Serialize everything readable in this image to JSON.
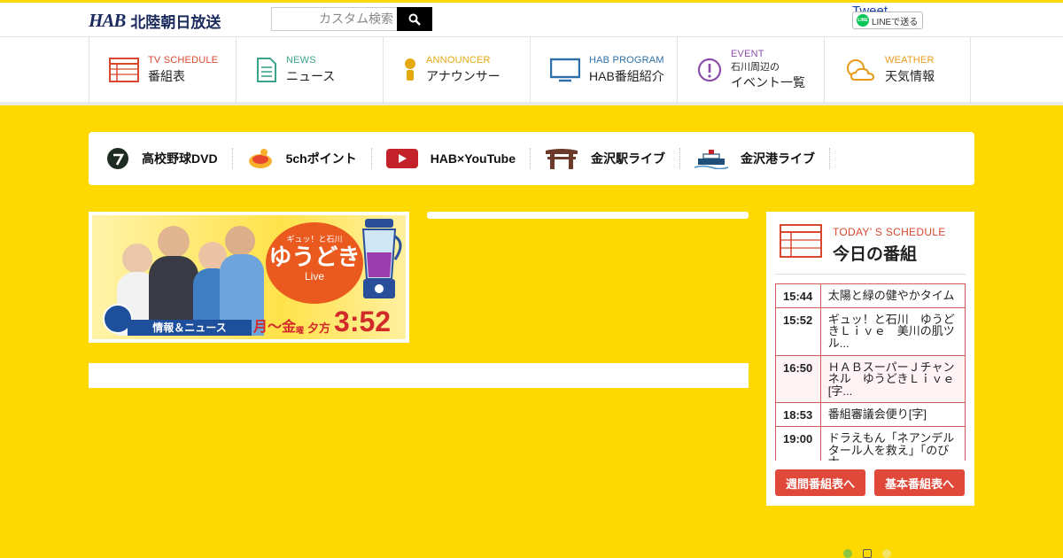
{
  "header": {
    "logo_mark": "HAB",
    "logo_name": "北陸朝日放送",
    "search_placeholder": "カスタム検索",
    "tweet_label": "Tweet",
    "line_label": "LINEで送る",
    "line_icon_text": "LINE"
  },
  "nav": [
    {
      "en": "TV SCHEDULE",
      "ja": "番組表",
      "color": "#d9482e",
      "icon": "tv-schedule-icon"
    },
    {
      "en": "NEWS",
      "ja": "ニュース",
      "color": "#3aa58b",
      "icon": "news-icon"
    },
    {
      "en": "ANNOUNCER",
      "ja": "アナウンサー",
      "color": "#e3a90f",
      "icon": "announcer-icon"
    },
    {
      "en": "HAB PROGRAM",
      "ja": "HAB番組紹介",
      "color": "#2d6fa8",
      "icon": "tv-monitor-icon"
    },
    {
      "en": "EVENT",
      "sub": "石川周辺の",
      "ja": "イベント一覧",
      "color": "#8a4ea8",
      "icon": "event-icon"
    },
    {
      "en": "WEATHER",
      "ja": "天気情報",
      "color": "#e89a1a",
      "icon": "weather-icon"
    }
  ],
  "quick_links": [
    {
      "label": "高校野球DVD",
      "icon": "baseball-dvd-icon"
    },
    {
      "label": "5chポイント",
      "icon": "5ch-point-icon"
    },
    {
      "label": "HAB×YouTube",
      "icon": "youtube-icon"
    },
    {
      "label": "金沢駅ライブ",
      "icon": "kanazawa-station-icon"
    },
    {
      "label": "金沢港ライブ",
      "icon": "kanazawa-port-icon"
    }
  ],
  "banner": {
    "tagline": "ギュッ！と石川",
    "title": "ゆうどき",
    "live": "Live",
    "genre": "情報＆ニュース",
    "days_prefix": "月〜金",
    "days_suffix": "曜",
    "period": "夕方",
    "time": "3:52"
  },
  "schedule": {
    "en_title": "TODAY’ S SCHEDULE",
    "ja_title": "今日の番組",
    "rows": [
      {
        "time": "15:44",
        "program": "太陽と緑の健やかタイム"
      },
      {
        "time": "15:52",
        "program": "ギュッ！と石川　ゆうどきＬｉｖｅ　美川の肌ツル..."
      },
      {
        "time": "16:50",
        "program": "ＨＡＢスーパーＪチャンネル　ゆうどきＬｉｖｅ[字..."
      },
      {
        "time": "18:53",
        "program": "番組審議会便り[字]"
      },
      {
        "time": "19:00",
        "program": "ドラえもん「ネアンデルタール人を救え」「のび太..."
      }
    ],
    "weekly_button": "週間番組表へ",
    "basic_button": "基本番組表へ"
  }
}
